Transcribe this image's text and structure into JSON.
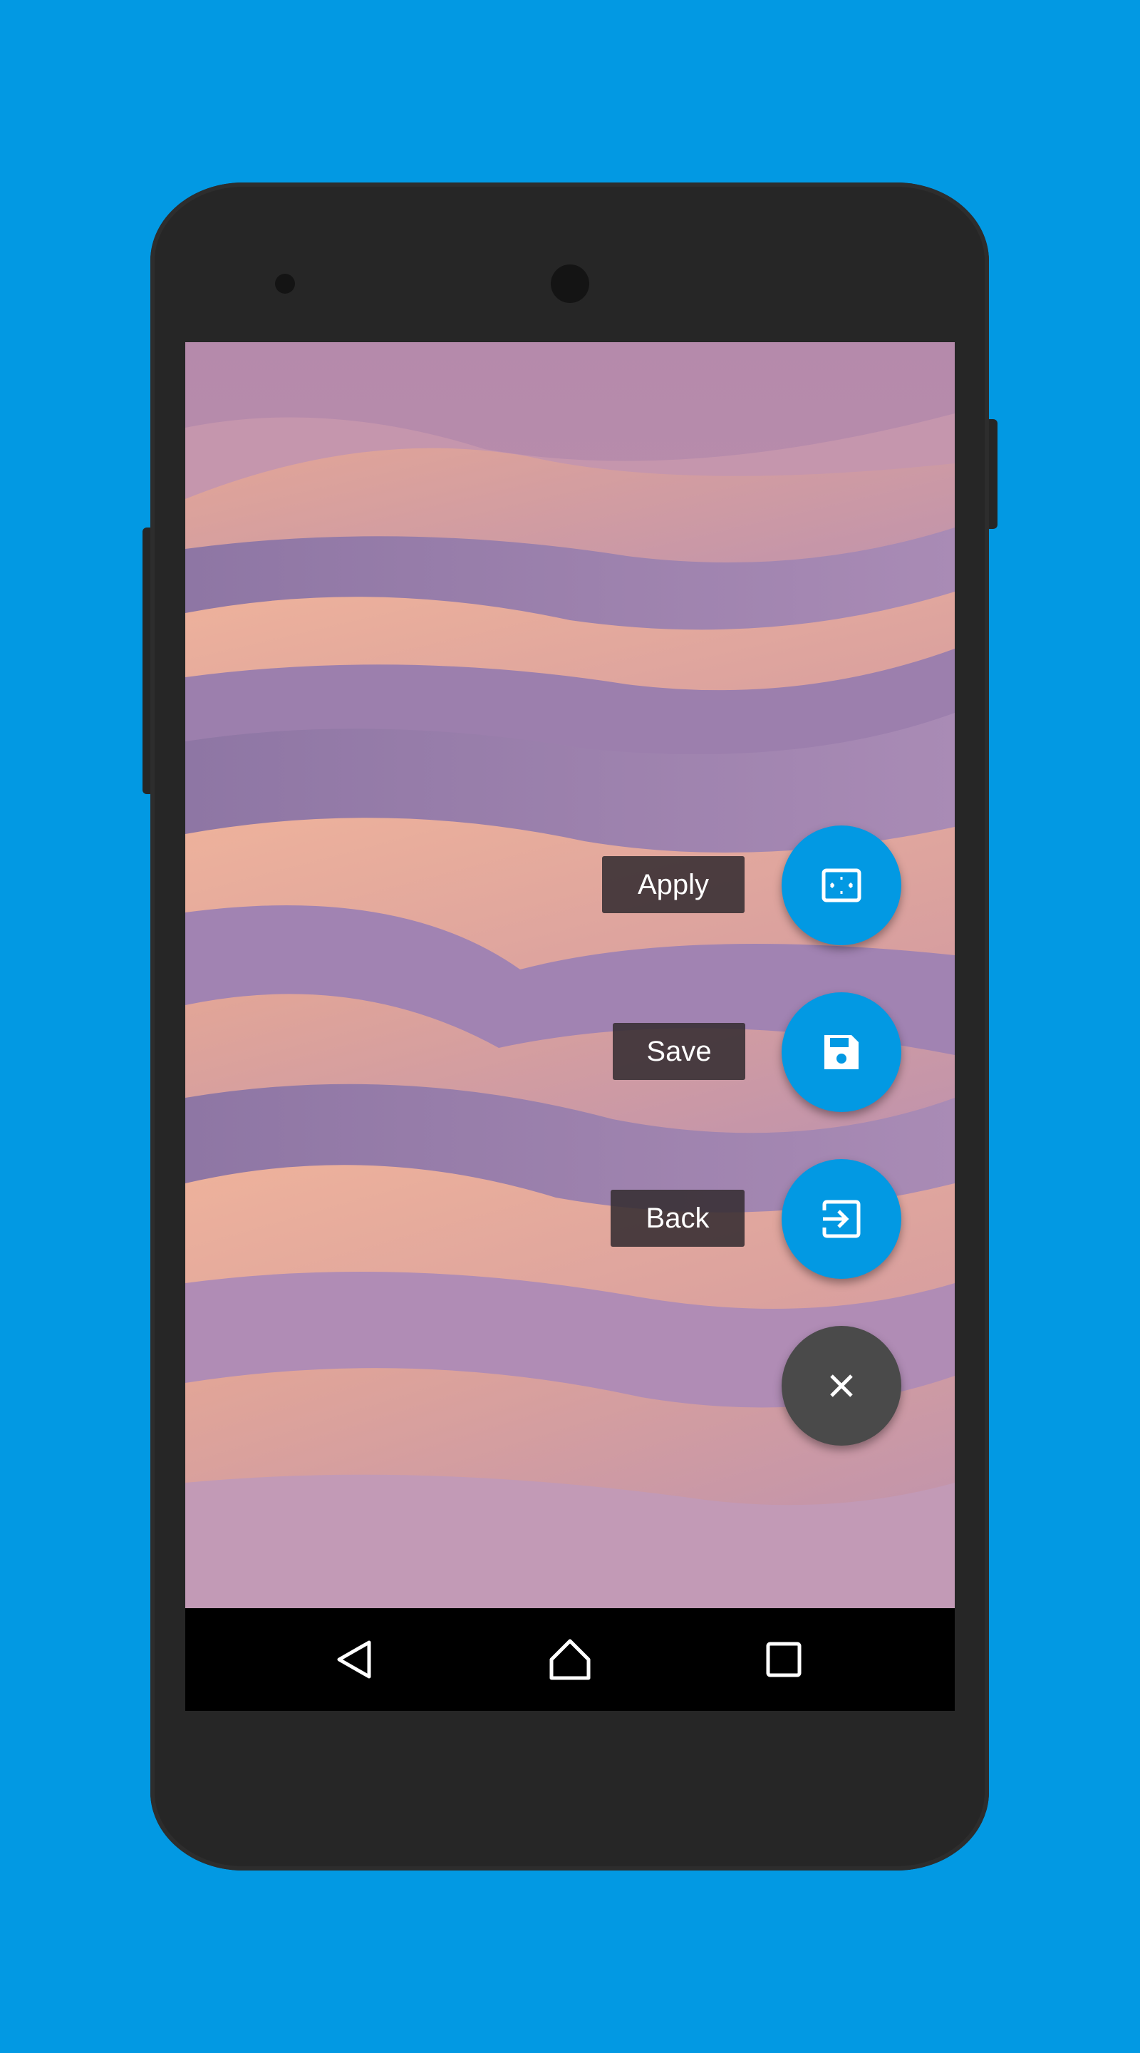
{
  "theme": {
    "background": "#0299e3",
    "phone_body": "#262626",
    "fab_accent": "#0299e3",
    "fab_close": "#4a4a4a",
    "navbar": "#000000"
  },
  "wallpaper": {
    "description_icon": "desert-dunes-wallpaper"
  },
  "fab_menu": {
    "items": [
      {
        "label": "Apply",
        "icon": "fullscreen-frame-icon"
      },
      {
        "label": "Save",
        "icon": "floppy-disk-icon"
      },
      {
        "label": "Back",
        "icon": "exit-to-app-icon"
      }
    ],
    "close_icon": "close-icon"
  },
  "navbar": {
    "buttons": [
      "back-triangle-icon",
      "home-icon",
      "recent-apps-icon"
    ]
  }
}
